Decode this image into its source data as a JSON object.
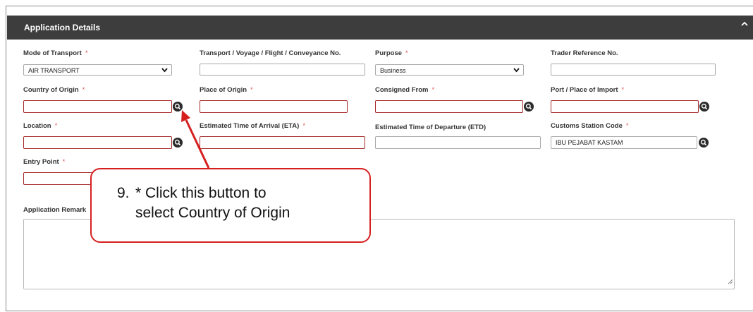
{
  "panel": {
    "title": "Application Details"
  },
  "fields": {
    "mode_of_transport": {
      "label": "Mode of Transport",
      "value": "AIR TRANSPORT"
    },
    "transport_no": {
      "label": "Transport / Voyage / Flight / Conveyance No.",
      "value": ""
    },
    "purpose": {
      "label": "Purpose",
      "value": "Business"
    },
    "trader_ref": {
      "label": "Trader Reference No.",
      "value": ""
    },
    "country_of_origin": {
      "label": "Country of Origin",
      "value": ""
    },
    "place_of_origin": {
      "label": "Place of Origin",
      "value": ""
    },
    "consigned_from": {
      "label": "Consigned From",
      "value": ""
    },
    "port_of_import": {
      "label": "Port / Place of Import",
      "value": ""
    },
    "location": {
      "label": "Location",
      "value": ""
    },
    "eta": {
      "label": "Estimated Time of Arrival (ETA)",
      "value": ""
    },
    "etd": {
      "label": "Estimated Time of Departure (ETD)",
      "value": ""
    },
    "customs_station": {
      "label": "Customs Station Code",
      "value": "IBU PEJABAT KASTAM"
    },
    "entry_point": {
      "label": "Entry Point",
      "value": ""
    },
    "remarks": {
      "label": "Application Remark",
      "value": ""
    }
  },
  "required_marker": "*",
  "callout": {
    "number": "9.",
    "line1": "* Click this button to",
    "line2": "select Country of Origin"
  },
  "colors": {
    "header_bg": "#3d3d3d",
    "required_border": "#a52a2a",
    "callout_border": "#d62020"
  },
  "icons": {
    "search": "magnifier-icon",
    "collapse": "chevron-up-icon",
    "dropdown": "chevron-down-icon"
  }
}
